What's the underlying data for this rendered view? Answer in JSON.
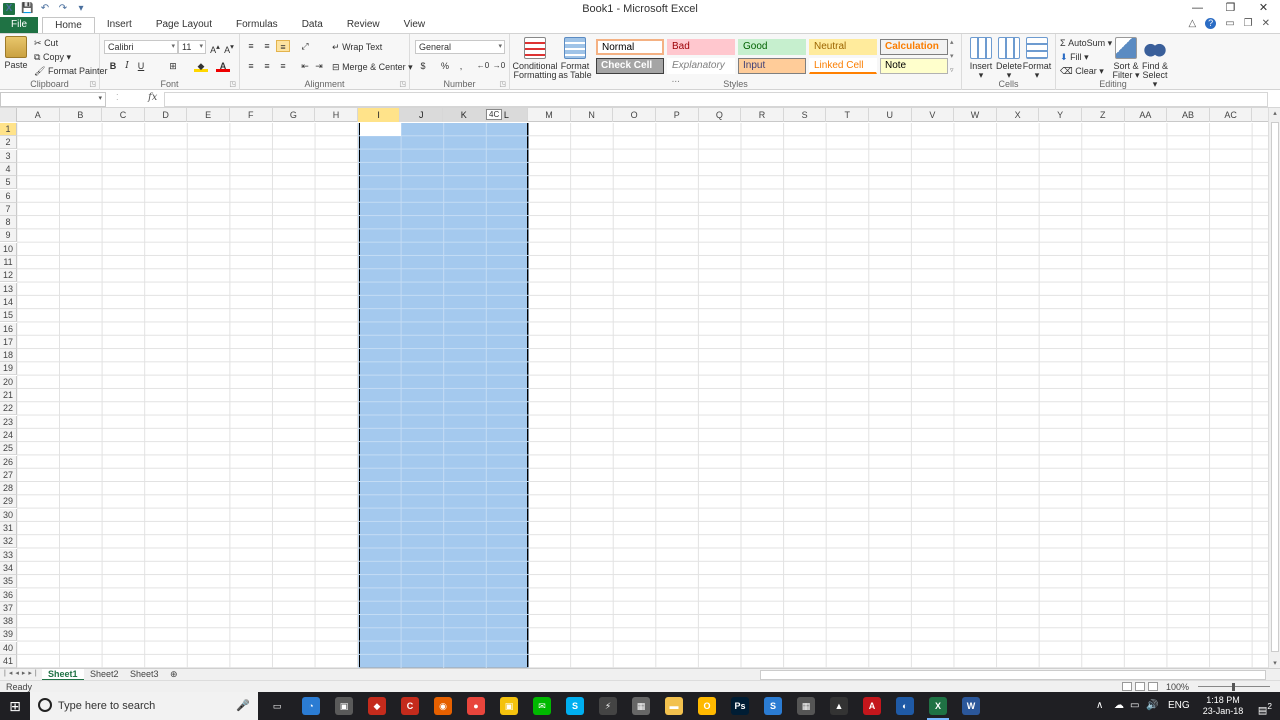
{
  "window": {
    "title": "Book1  -  Microsoft Excel",
    "minimize": "—",
    "restore": "❐",
    "close": "✕"
  },
  "ribbon_tabs": [
    "File",
    "Home",
    "Insert",
    "Page Layout",
    "Formulas",
    "Data",
    "Review",
    "View"
  ],
  "active_tab": "Home",
  "clipboard": {
    "paste": "Paste",
    "cut": "Cut",
    "copy": "Copy",
    "format_painter": "Format Painter",
    "label": "Clipboard"
  },
  "font": {
    "name": "Calibri",
    "size": "11",
    "bold": "B",
    "italic": "I",
    "underline": "U",
    "label": "Font"
  },
  "alignment": {
    "wrap_text": "Wrap Text",
    "merge_center": "Merge & Center",
    "label": "Alignment"
  },
  "number": {
    "format": "General",
    "currency": "$",
    "percent": "%",
    "comma": ",",
    "label": "Number"
  },
  "styles": {
    "conditional_formatting": [
      "Conditional",
      "Formatting"
    ],
    "format_as_table": [
      "Format",
      "as Table"
    ],
    "cells": [
      {
        "label": "Normal",
        "bg": "#ffffff",
        "fg": "#000000",
        "border": "#f4b183"
      },
      {
        "label": "Bad",
        "bg": "#ffc7ce",
        "fg": "#9c0006",
        "border": "#ffc7ce"
      },
      {
        "label": "Good",
        "bg": "#c6efce",
        "fg": "#006100",
        "border": "#c6efce"
      },
      {
        "label": "Neutral",
        "bg": "#ffeb9c",
        "fg": "#9c6500",
        "border": "#ffeb9c"
      },
      {
        "label": "Calculation",
        "bg": "#f2f2f2",
        "fg": "#fa7d00",
        "border": "#7f7f7f"
      },
      {
        "label": "Check Cell",
        "bg": "#a5a5a5",
        "fg": "#ffffff",
        "border": "#3f3f3f"
      },
      {
        "label": "Explanatory ...",
        "bg": "#ffffff",
        "fg": "#7f7f7f",
        "border": "#ffffff"
      },
      {
        "label": "Input",
        "bg": "#ffcc99",
        "fg": "#3f3f76",
        "border": "#7f7f7f"
      },
      {
        "label": "Linked Cell",
        "bg": "#ffffff",
        "fg": "#fa7d00",
        "border": "#ffffff"
      },
      {
        "label": "Note",
        "bg": "#ffffcc",
        "fg": "#000000",
        "border": "#b2b2b2"
      }
    ],
    "label": "Styles"
  },
  "cells_group": {
    "insert": "Insert",
    "delete": "Delete",
    "format": "Format",
    "label": "Cells"
  },
  "editing": {
    "autosum": "AutoSum",
    "fill": "Fill",
    "clear": "Clear",
    "sort_filter": [
      "Sort &",
      "Filter"
    ],
    "find_select": [
      "Find &",
      "Select"
    ],
    "label": "Editing"
  },
  "formula_bar": {
    "name_box": "",
    "fx": "fx",
    "value": ""
  },
  "columns": [
    "A",
    "B",
    "C",
    "D",
    "E",
    "F",
    "G",
    "H",
    "I",
    "J",
    "K",
    "L",
    "M",
    "N",
    "O",
    "P",
    "Q",
    "R",
    "S",
    "T",
    "U",
    "V",
    "W",
    "X",
    "Y",
    "Z",
    "AA",
    "AB",
    "AC"
  ],
  "selected_columns": [
    "I",
    "J",
    "K",
    "L"
  ],
  "active_column": "I",
  "active_row": "1",
  "rows": [
    "1",
    "2",
    "3",
    "4",
    "5",
    "6",
    "7",
    "8",
    "9",
    "10",
    "11",
    "12",
    "13",
    "14",
    "15",
    "16",
    "17",
    "18",
    "19",
    "20",
    "21",
    "22",
    "23",
    "24",
    "25",
    "26",
    "27",
    "28",
    "29",
    "30",
    "31",
    "32",
    "33",
    "34",
    "35",
    "36",
    "37",
    "38",
    "39",
    "40",
    "41"
  ],
  "drag_tooltip": "4C",
  "sheets": [
    "Sheet1",
    "Sheet2",
    "Sheet3"
  ],
  "active_sheet": "Sheet1",
  "status": {
    "ready": "Ready",
    "zoom": "100%"
  },
  "taskbar": {
    "search_placeholder": "Type here to search",
    "language": "ENG",
    "time": "1:18 PM",
    "date": "23-Jan-18",
    "notifications": "2"
  },
  "colors": {
    "excel_green": "#1f7244",
    "selection": "#a4c9ee",
    "active_header": "#ffe38a"
  }
}
